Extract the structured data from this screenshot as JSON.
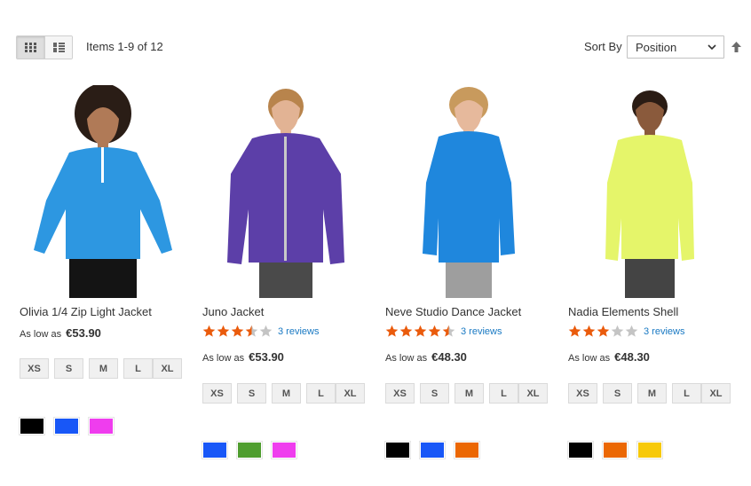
{
  "toolbar": {
    "view_modes": [
      "grid-icon",
      "list-icon"
    ],
    "amount": "Items 1-9 of 12",
    "sort_label": "Sort By",
    "sort_value": "Position",
    "sort_direction_icon": "arrow-up-icon"
  },
  "colors": {
    "star_filled": "#ea5b0c",
    "star_empty": "#c4c4c4",
    "link": "#1979c3"
  },
  "products": [
    {
      "name": "Olivia 1/4 Zip Light Jacket",
      "price_prefix": "As low as",
      "price": "€53.90",
      "sizes": [
        "XS",
        "S",
        "M",
        "L",
        "XL"
      ],
      "swatches": [
        "#000000",
        "#1857f7",
        "#ef3dee"
      ],
      "garment_color": "#2d97e1"
    },
    {
      "name": "Juno Jacket",
      "rating": 3.5,
      "reviews": "3 reviews",
      "price_prefix": "As low as",
      "price": "€53.90",
      "sizes": [
        "XS",
        "S",
        "M",
        "L",
        "XL"
      ],
      "swatches": [
        "#1857f7",
        "#4f9d2f",
        "#ef3dee"
      ],
      "garment_color": "#5c3fa8"
    },
    {
      "name": "Neve Studio Dance Jacket",
      "rating": 4.5,
      "reviews": "3 reviews",
      "price_prefix": "As low as",
      "price": "€48.30",
      "sizes": [
        "XS",
        "S",
        "M",
        "L",
        "XL"
      ],
      "swatches": [
        "#000000",
        "#1857f7",
        "#eb6703"
      ],
      "garment_color": "#1f87dd"
    },
    {
      "name": "Nadia Elements Shell",
      "rating": 3,
      "reviews": "3 reviews",
      "price_prefix": "As low as",
      "price": "€48.30",
      "sizes": [
        "XS",
        "S",
        "M",
        "L",
        "XL"
      ],
      "swatches": [
        "#000000",
        "#eb6703",
        "#f7c90a"
      ],
      "garment_color": "#e5f56a"
    }
  ]
}
